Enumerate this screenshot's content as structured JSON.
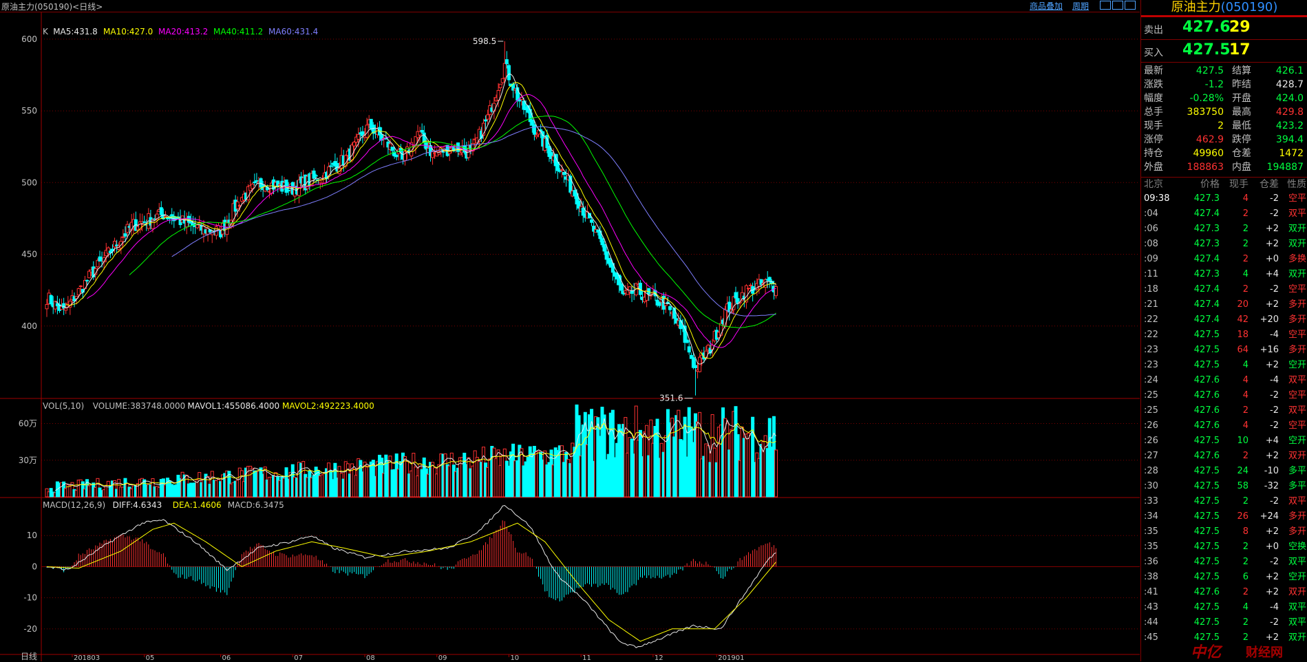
{
  "window": {
    "title": "原油主力(050190)<日线>",
    "links": [
      "商品叠加",
      "周期"
    ]
  },
  "kline": {
    "ma_legend": [
      {
        "label": "K",
        "color": "#c0c0c0"
      },
      {
        "label": "MA5:431.8",
        "color": "#e8e8e8"
      },
      {
        "label": "MA10:427.0",
        "color": "#ffff00"
      },
      {
        "label": "MA20:413.2",
        "color": "#ff00ff"
      },
      {
        "label": "MA40:411.2",
        "color": "#00ff00"
      },
      {
        "label": "MA60:431.4",
        "color": "#7f7fff"
      }
    ],
    "y_ticks": [
      "600",
      "550",
      "500",
      "450",
      "400"
    ],
    "high_label": "598.5",
    "low_label": "351.6"
  },
  "volume": {
    "legend": [
      {
        "label": "VOL(5,10)",
        "color": "#c0c0c0"
      },
      {
        "label": "VOLUME:383748.0000",
        "color": "#c0c0c0"
      },
      {
        "label": "MAVOL1:455086.4000",
        "color": "#e8e8e8"
      },
      {
        "label": "MAVOL2:492223.4000",
        "color": "#ffff00"
      }
    ],
    "y_ticks": [
      "60万",
      "30万"
    ]
  },
  "macd": {
    "legend": [
      {
        "label": "MACD(12,26,9)",
        "color": "#c0c0c0"
      },
      {
        "label": "DIFF:4.6343",
        "color": "#e8e8e8"
      },
      {
        "label": "DEA:1.4606",
        "color": "#ffff00"
      },
      {
        "label": "MACD:6.3475",
        "color": "#c0c0c0"
      }
    ],
    "y_ticks": [
      "10",
      "0",
      "-10",
      "-20"
    ]
  },
  "x_axis": {
    "labels": [
      "日线",
      "201803",
      "05",
      "06",
      "07",
      "08",
      "09",
      "10",
      "11",
      "12",
      "201901"
    ]
  },
  "chart_data": {
    "type": "candlestick",
    "title": "原油主力(050190)<日线>",
    "ylim_price": [
      350,
      610
    ],
    "price_ticks": [
      400,
      450,
      500,
      550,
      600
    ],
    "annotations": [
      {
        "text": "598.5",
        "value": 598.5
      },
      {
        "text": "351.6",
        "value": 351.6
      }
    ],
    "anchors_close": [
      [
        0,
        420
      ],
      [
        8,
        410
      ],
      [
        22,
        438
      ],
      [
        40,
        470
      ],
      [
        55,
        478
      ],
      [
        72,
        468
      ],
      [
        82,
        466
      ],
      [
        92,
        490
      ],
      [
        102,
        500
      ],
      [
        115,
        495
      ],
      [
        130,
        505
      ],
      [
        142,
        518
      ],
      [
        152,
        540
      ],
      [
        160,
        528
      ],
      [
        168,
        515
      ],
      [
        175,
        535
      ],
      [
        182,
        520
      ],
      [
        192,
        525
      ],
      [
        200,
        520
      ],
      [
        208,
        545
      ],
      [
        216,
        582
      ],
      [
        222,
        560
      ],
      [
        230,
        538
      ],
      [
        240,
        515
      ],
      [
        250,
        490
      ],
      [
        262,
        455
      ],
      [
        272,
        420
      ],
      [
        278,
        425
      ],
      [
        284,
        420
      ],
      [
        292,
        415
      ],
      [
        300,
        395
      ],
      [
        306,
        370
      ],
      [
        313,
        385
      ],
      [
        320,
        410
      ],
      [
        330,
        425
      ],
      [
        340,
        430
      ],
      [
        344,
        427
      ]
    ],
    "volume_ylim": [
      0,
      800000
    ],
    "volume_last": 383748,
    "macd_ylim": [
      -28,
      22
    ],
    "diff_anchors": [
      [
        0,
        0
      ],
      [
        10,
        -1
      ],
      [
        30,
        8
      ],
      [
        45,
        14
      ],
      [
        55,
        15
      ],
      [
        70,
        8
      ],
      [
        85,
        -1
      ],
      [
        100,
        6
      ],
      [
        115,
        8
      ],
      [
        125,
        10
      ],
      [
        135,
        6
      ],
      [
        150,
        3
      ],
      [
        170,
        5
      ],
      [
        190,
        6
      ],
      [
        205,
        12
      ],
      [
        216,
        20
      ],
      [
        228,
        13
      ],
      [
        240,
        -2
      ],
      [
        255,
        -12
      ],
      [
        270,
        -24
      ],
      [
        278,
        -26
      ],
      [
        290,
        -23
      ],
      [
        305,
        -19
      ],
      [
        318,
        -20
      ],
      [
        330,
        -8
      ],
      [
        340,
        2
      ],
      [
        344,
        4.6
      ]
    ],
    "dea_anchors": [
      [
        0,
        0
      ],
      [
        15,
        -0.5
      ],
      [
        35,
        5
      ],
      [
        50,
        12
      ],
      [
        60,
        14
      ],
      [
        75,
        8
      ],
      [
        92,
        0
      ],
      [
        108,
        5
      ],
      [
        125,
        8
      ],
      [
        140,
        6
      ],
      [
        160,
        3
      ],
      [
        180,
        5
      ],
      [
        200,
        8
      ],
      [
        222,
        14
      ],
      [
        235,
        8
      ],
      [
        250,
        -5
      ],
      [
        265,
        -17
      ],
      [
        280,
        -24
      ],
      [
        295,
        -20
      ],
      [
        315,
        -20
      ],
      [
        330,
        -10
      ],
      [
        344,
        1.5
      ]
    ]
  },
  "quote": {
    "name": "原油主力",
    "code": "(050190)",
    "sell_label": "卖出",
    "sell_price": "427.6",
    "sell_vol": "29",
    "buy_label": "买入",
    "buy_price": "427.5",
    "buy_vol": "17"
  },
  "stats": [
    {
      "l": "最新",
      "v": "427.5",
      "vc": "green",
      "l2": "结算",
      "v2": "426.1",
      "v2c": "green"
    },
    {
      "l": "涨跌",
      "v": "-1.2",
      "vc": "green",
      "l2": "昨结",
      "v2": "428.7",
      "v2c": "white"
    },
    {
      "l": "幅度",
      "v": "-0.28%",
      "vc": "green",
      "l2": "开盘",
      "v2": "424.0",
      "v2c": "green"
    },
    {
      "l": "总手",
      "v": "383750",
      "vc": "yellow",
      "l2": "最高",
      "v2": "429.8",
      "v2c": "red"
    },
    {
      "l": "现手",
      "v": "2",
      "vc": "yellow",
      "l2": "最低",
      "v2": "423.2",
      "v2c": "green"
    },
    {
      "l": "涨停",
      "v": "462.9",
      "vc": "red",
      "l2": "跌停",
      "v2": "394.4",
      "v2c": "green"
    },
    {
      "l": "持仓",
      "v": "49960",
      "vc": "yellow",
      "l2": "仓差",
      "v2": "1472",
      "v2c": "yellow"
    },
    {
      "l": "外盘",
      "v": "188863",
      "vc": "red",
      "l2": "内盘",
      "v2": "194887",
      "v2c": "green"
    }
  ],
  "ticks_header": [
    "北京",
    "价格",
    "现手",
    "仓差",
    "性质"
  ],
  "ticks": [
    {
      "t": "09:38",
      "p": "427.3",
      "q": "4",
      "qc": "red",
      "d": "-2",
      "n": "空平",
      "nc": "red"
    },
    {
      "t": ":04",
      "p": "427.4",
      "q": "2",
      "qc": "red",
      "d": "-2",
      "n": "双平",
      "nc": "red"
    },
    {
      "t": ":06",
      "p": "427.3",
      "q": "2",
      "qc": "green",
      "d": "+2",
      "n": "双开",
      "nc": "green"
    },
    {
      "t": ":08",
      "p": "427.3",
      "q": "2",
      "qc": "green",
      "d": "+2",
      "n": "双开",
      "nc": "green"
    },
    {
      "t": ":09",
      "p": "427.4",
      "q": "2",
      "qc": "red",
      "d": "+0",
      "n": "多换",
      "nc": "red"
    },
    {
      "t": ":11",
      "p": "427.3",
      "q": "4",
      "qc": "green",
      "d": "+4",
      "n": "双开",
      "nc": "green"
    },
    {
      "t": ":18",
      "p": "427.4",
      "q": "2",
      "qc": "red",
      "d": "-2",
      "n": "空平",
      "nc": "red"
    },
    {
      "t": ":21",
      "p": "427.4",
      "q": "20",
      "qc": "red",
      "d": "+2",
      "n": "多开",
      "nc": "red"
    },
    {
      "t": ":22",
      "p": "427.4",
      "q": "42",
      "qc": "red",
      "d": "+20",
      "n": "多开",
      "nc": "red"
    },
    {
      "t": ":22",
      "p": "427.5",
      "q": "18",
      "qc": "red",
      "d": "-4",
      "n": "空平",
      "nc": "red"
    },
    {
      "t": ":23",
      "p": "427.5",
      "q": "64",
      "qc": "red",
      "d": "+16",
      "n": "多开",
      "nc": "red"
    },
    {
      "t": ":23",
      "p": "427.5",
      "q": "4",
      "qc": "green",
      "d": "+2",
      "n": "空开",
      "nc": "green"
    },
    {
      "t": ":24",
      "p": "427.6",
      "q": "4",
      "qc": "red",
      "d": "-4",
      "n": "双平",
      "nc": "red"
    },
    {
      "t": ":25",
      "p": "427.6",
      "q": "4",
      "qc": "red",
      "d": "-2",
      "n": "空平",
      "nc": "red"
    },
    {
      "t": ":25",
      "p": "427.6",
      "q": "2",
      "qc": "red",
      "d": "-2",
      "n": "双平",
      "nc": "red"
    },
    {
      "t": ":26",
      "p": "427.6",
      "q": "4",
      "qc": "red",
      "d": "-2",
      "n": "空平",
      "nc": "red"
    },
    {
      "t": ":26",
      "p": "427.5",
      "q": "10",
      "qc": "green",
      "d": "+4",
      "n": "空开",
      "nc": "green"
    },
    {
      "t": ":27",
      "p": "427.6",
      "q": "2",
      "qc": "red",
      "d": "+2",
      "n": "双开",
      "nc": "red"
    },
    {
      "t": ":28",
      "p": "427.5",
      "q": "24",
      "qc": "green",
      "d": "-10",
      "n": "多平",
      "nc": "green"
    },
    {
      "t": ":30",
      "p": "427.5",
      "q": "58",
      "qc": "green",
      "d": "-32",
      "n": "多平",
      "nc": "green"
    },
    {
      "t": ":33",
      "p": "427.5",
      "q": "2",
      "qc": "green",
      "d": "-2",
      "n": "双平",
      "nc": "red"
    },
    {
      "t": ":34",
      "p": "427.5",
      "q": "26",
      "qc": "red",
      "d": "+24",
      "n": "多开",
      "nc": "red"
    },
    {
      "t": ":35",
      "p": "427.5",
      "q": "8",
      "qc": "red",
      "d": "+2",
      "n": "多开",
      "nc": "red"
    },
    {
      "t": ":35",
      "p": "427.5",
      "q": "2",
      "qc": "green",
      "d": "+0",
      "n": "空换",
      "nc": "green"
    },
    {
      "t": ":36",
      "p": "427.5",
      "q": "2",
      "qc": "green",
      "d": "-2",
      "n": "双平",
      "nc": "green"
    },
    {
      "t": ":38",
      "p": "427.5",
      "q": "6",
      "qc": "green",
      "d": "+2",
      "n": "空开",
      "nc": "green"
    },
    {
      "t": ":41",
      "p": "427.6",
      "q": "2",
      "qc": "red",
      "d": "+2",
      "n": "双开",
      "nc": "red"
    },
    {
      "t": ":43",
      "p": "427.5",
      "q": "4",
      "qc": "green",
      "d": "-4",
      "n": "双平",
      "nc": "green"
    },
    {
      "t": ":44",
      "p": "427.5",
      "q": "2",
      "qc": "green",
      "d": "-2",
      "n": "双平",
      "nc": "green"
    },
    {
      "t": ":45",
      "p": "427.5",
      "q": "2",
      "qc": "green",
      "d": "+2",
      "n": "双开",
      "nc": "green"
    }
  ],
  "watermark": {
    "a": "中亿",
    "b": "财经网"
  }
}
